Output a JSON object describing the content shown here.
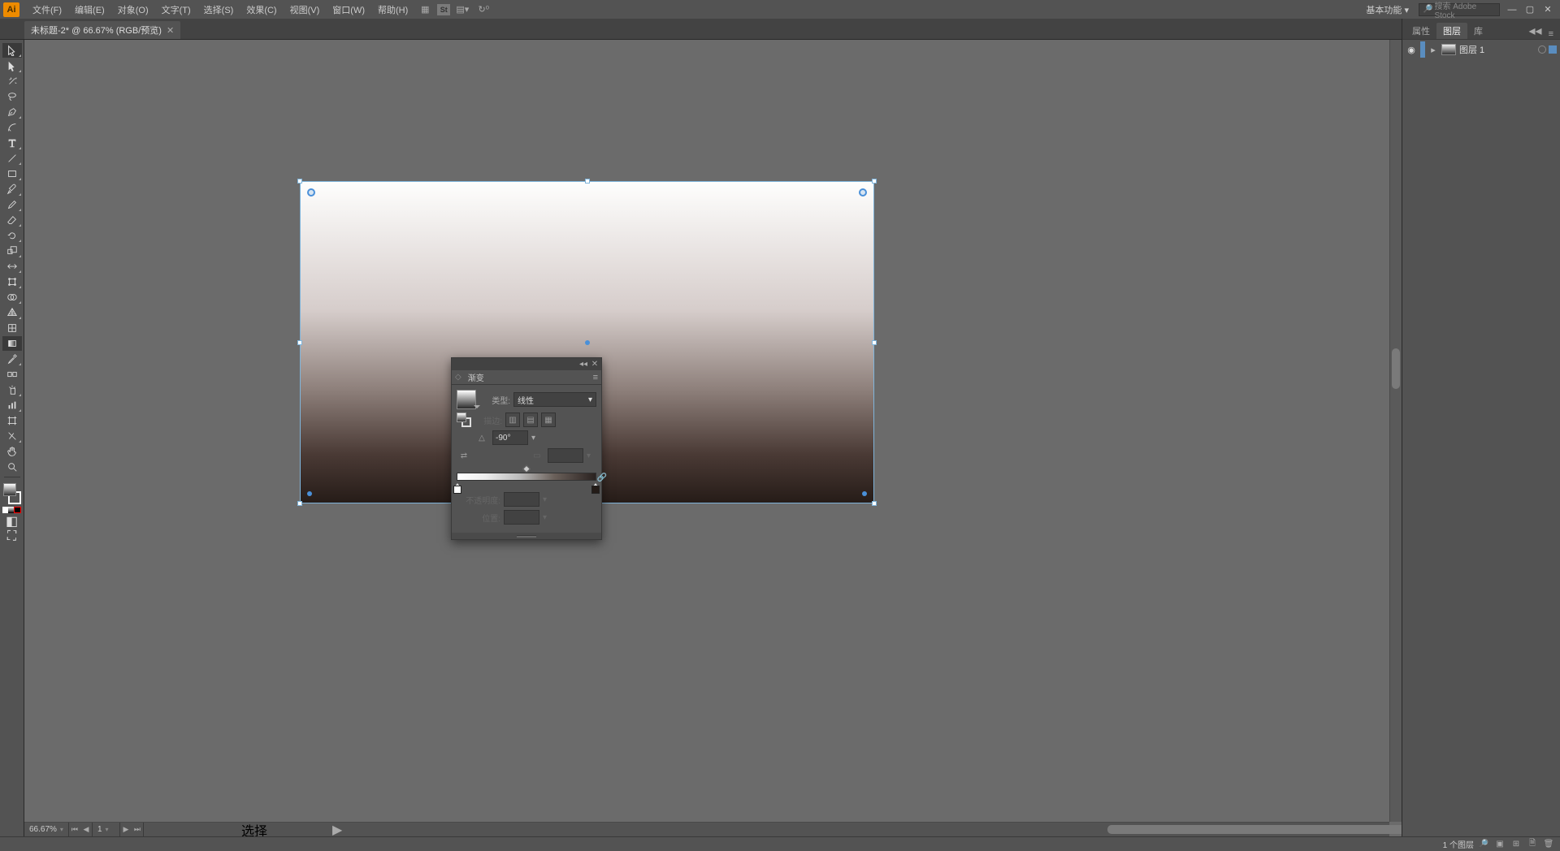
{
  "menubar": {
    "items": [
      "文件(F)",
      "编辑(E)",
      "对象(O)",
      "文字(T)",
      "选择(S)",
      "效果(C)",
      "视图(V)",
      "窗口(W)",
      "帮助(H)"
    ],
    "workspace": "基本功能",
    "search_placeholder": "搜索 Adobe Stock"
  },
  "tab": {
    "title": "未标题-2* @ 66.67% (RGB/预览)"
  },
  "tools": [
    "selection-tool",
    "direct-selection-tool",
    "magic-wand-tool",
    "lasso-tool",
    "pen-tool",
    "curvature-tool",
    "type-tool",
    "line-segment-tool",
    "rectangle-tool",
    "paintbrush-tool",
    "pencil-tool",
    "eraser-tool",
    "rotate-tool",
    "scale-tool",
    "width-tool",
    "free-transform-tool",
    "shape-builder-tool",
    "perspective-grid-tool",
    "mesh-tool",
    "gradient-tool",
    "eyedropper-tool",
    "blend-tool",
    "symbol-sprayer-tool",
    "column-graph-tool",
    "artboard-tool",
    "slice-tool",
    "hand-tool",
    "zoom-tool"
  ],
  "gradient_panel": {
    "title": "渐变",
    "type_label": "类型:",
    "type_value": "线性",
    "stroke_label": "描边:",
    "angle_value": "-90°",
    "ratio_value": "",
    "opacity_label": "不透明度:",
    "opacity_value": "",
    "location_label": "位置:",
    "location_value": "",
    "stops": [
      {
        "position": 0,
        "color": "#ffffff"
      },
      {
        "position": 100,
        "color": "#241c18"
      }
    ]
  },
  "right_panel": {
    "tabs": [
      "属性",
      "图层",
      "库"
    ],
    "active_tab": 1,
    "layer": {
      "name": "图层 1"
    }
  },
  "status": {
    "zoom": "66.67%",
    "page": "1",
    "tool": "选择",
    "layer_count": "1 个图层"
  }
}
